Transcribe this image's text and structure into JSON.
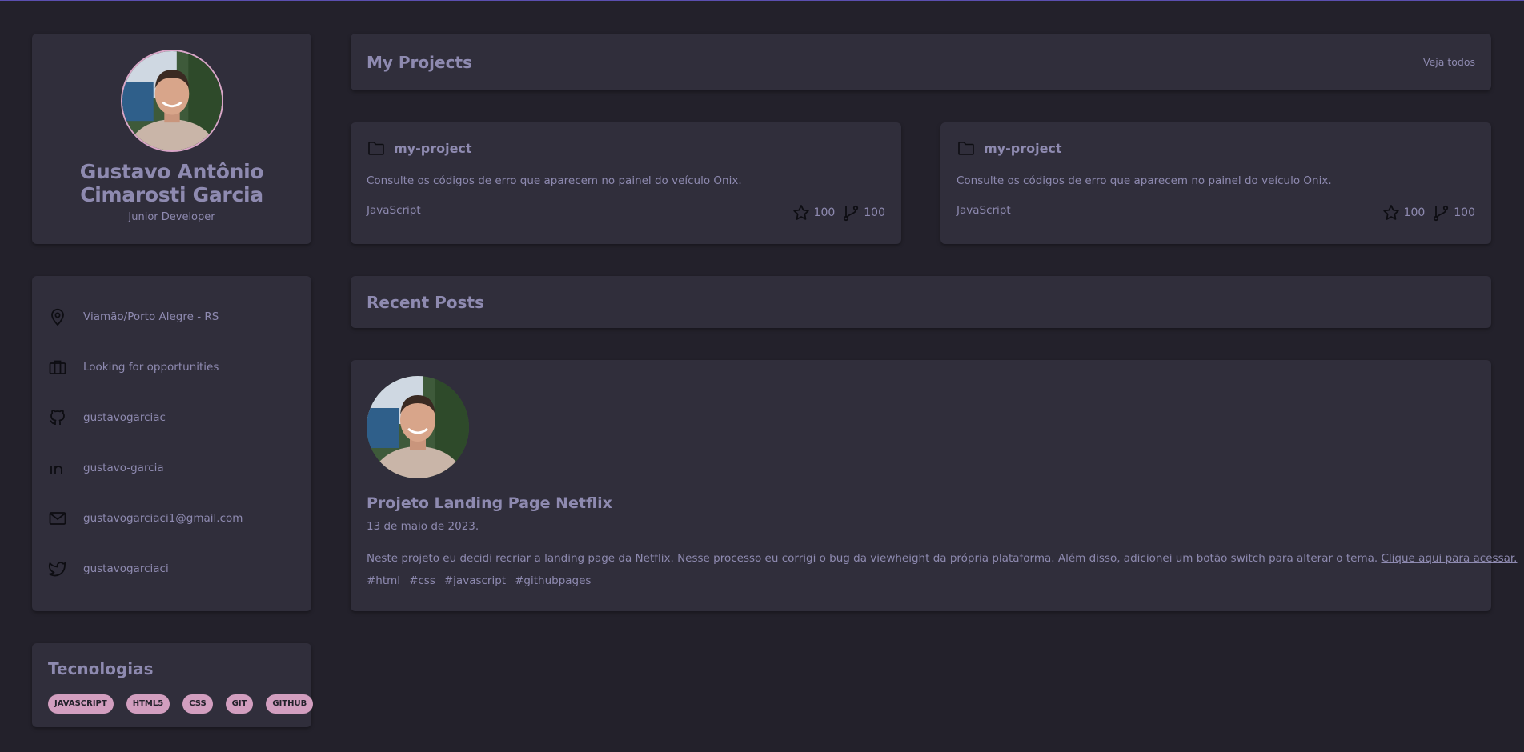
{
  "profile": {
    "name": "Gustavo Antônio Cimarosti Garcia",
    "role": "Junior Developer",
    "avatar_icon": "avatar-photo"
  },
  "info": {
    "location": "Viamão/Porto Alegre - RS",
    "work": "Looking for opportunities",
    "github": "gustavogarciac",
    "linkedin": "gustavo-garcia",
    "email": "gustavogarciaci1@gmail.com",
    "twitter": "gustavogarciaci"
  },
  "tech": {
    "title": "Tecnologias",
    "tags": [
      "JAVASCRIPT",
      "HTML5",
      "CSS",
      "GIT",
      "GITHUB"
    ]
  },
  "projects_header": {
    "title": "My Projects",
    "see_all": "Veja todos"
  },
  "projects": [
    {
      "name": "my-project",
      "description": "Consulte os códigos de erro que aparecem no painel do veículo Onix.",
      "language": "JavaScript",
      "stars": "100",
      "forks": "100"
    },
    {
      "name": "my-project",
      "description": "Consulte os códigos de erro que aparecem no painel do veículo Onix.",
      "language": "JavaScript",
      "stars": "100",
      "forks": "100"
    }
  ],
  "posts_header": {
    "title": "Recent Posts"
  },
  "post": {
    "title": "Projeto Landing Page Netflix",
    "date": "13 de maio de 2023.",
    "body": "Neste projeto eu decidi recriar a landing page da Netflix. Nesse processo eu corrigi o bug da viewheight da própria plataforma. Além disso, adicionei um botão switch para alterar o tema.",
    "link_text": "Clique aqui para acessar.",
    "hashtags": [
      "#html",
      "#css",
      "#javascript",
      "#githubpages"
    ]
  },
  "colors": {
    "background": "#23212b",
    "card": "#302e3b",
    "text": "#8e8ab0",
    "tag": "#d29ebf",
    "avatar_border": "#d9a6c7"
  }
}
